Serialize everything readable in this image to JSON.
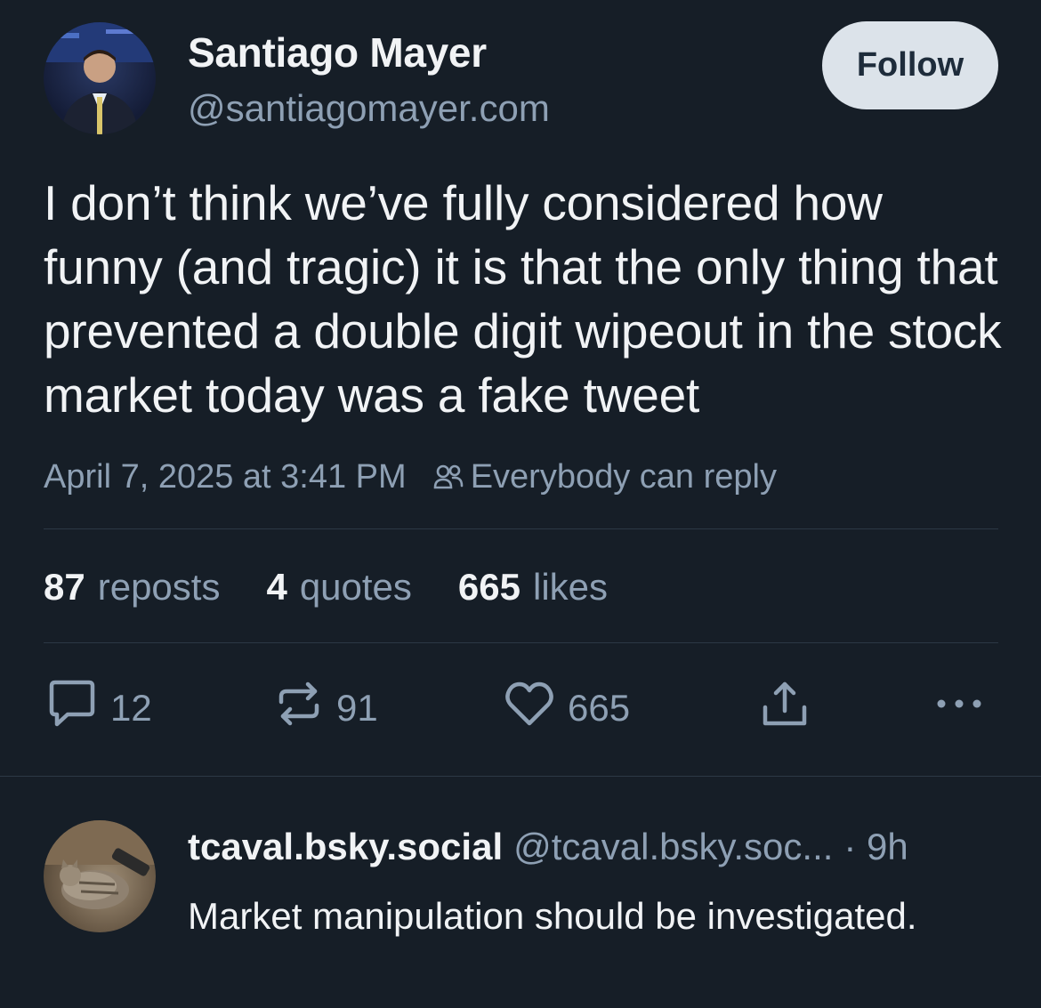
{
  "post": {
    "author": {
      "name": "Santiago Mayer",
      "handle": "@santiagomayer.com"
    },
    "follow_label": "Follow",
    "text": "I don’t think we’ve fully considered how funny (and tragic) it is that the only thing that prevented a double digit wipeout in the stock market today was a fake tweet",
    "timestamp": "April 7, 2025 at 3:41 PM",
    "reply_setting": "Everybody can reply",
    "stats": {
      "reposts_count": "87",
      "reposts_label": "reposts",
      "quotes_count": "4",
      "quotes_label": "quotes",
      "likes_count": "665",
      "likes_label": "likes"
    },
    "actions": {
      "reply_count": "12",
      "repost_count": "91",
      "like_count": "665"
    }
  },
  "reply": {
    "name": "tcaval.bsky.social",
    "handle": "@tcaval.bsky.soc...",
    "time": "· 9h",
    "text": "Market manipulation should be investigated."
  },
  "colors": {
    "background": "#161e27",
    "text_primary": "#f1f3f5",
    "text_secondary": "#8ea0b4",
    "divider": "#2c3845",
    "follow_bg": "#dce3ea"
  },
  "icons": [
    "people-icon",
    "reply-icon",
    "repost-icon",
    "heart-icon",
    "share-icon",
    "more-icon"
  ]
}
